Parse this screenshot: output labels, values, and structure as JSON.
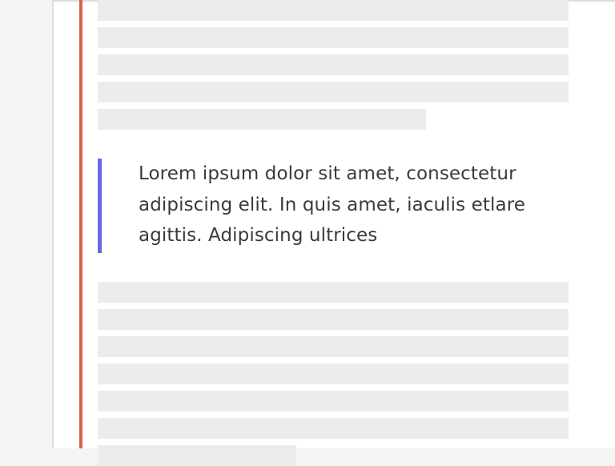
{
  "quote": {
    "text": "Lorem ipsum dolor sit amet, consectetur adipiscing elit. In quis amet, iaculis etlare agittis. Adipiscing ultrices"
  },
  "colors": {
    "margin_rule": "#d6624f",
    "quote_accent": "#6a67e6",
    "placeholder": "#ececec",
    "text": "#3a3a3a"
  }
}
